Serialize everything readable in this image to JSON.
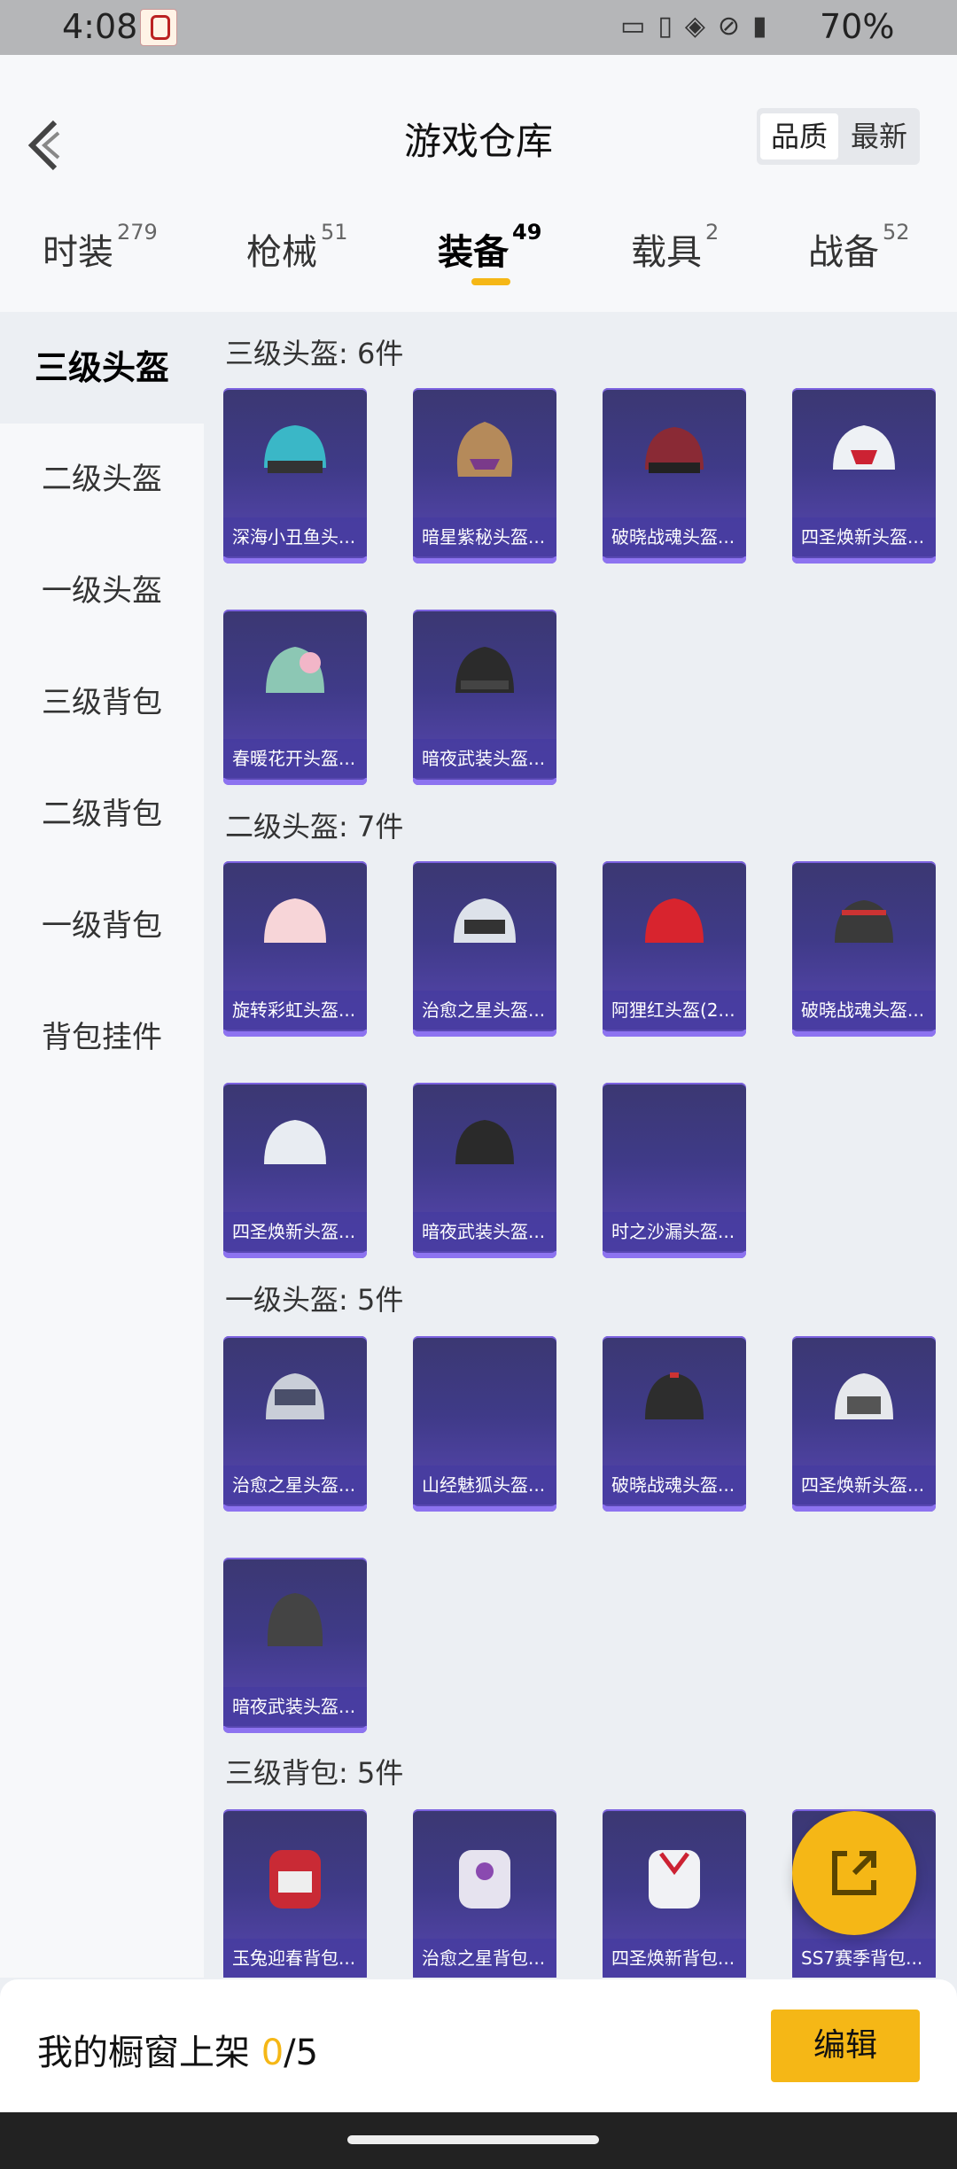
{
  "status_bar": {
    "time": "4:08",
    "battery": "70%"
  },
  "header": {
    "title": "游戏仓库",
    "sort_options": [
      "品质",
      "最新"
    ]
  },
  "tabs": [
    {
      "label": "时装",
      "count": "279"
    },
    {
      "label": "枪械",
      "count": "51"
    },
    {
      "label": "装备",
      "count": "49"
    },
    {
      "label": "载具",
      "count": "2"
    },
    {
      "label": "战备",
      "count": "52"
    }
  ],
  "sidebar": [
    "三级头盔",
    "二级头盔",
    "一级头盔",
    "三级背包",
    "二级背包",
    "一级背包",
    "背包挂件"
  ],
  "sections": [
    {
      "title": "三级头盔: 6件",
      "items": [
        "深海小丑鱼头...",
        "暗星紫秘头盔...",
        "破晓战魂头盔...",
        "四圣焕新头盔...",
        "春暖花开头盔...",
        "暗夜武装头盔..."
      ]
    },
    {
      "title": "二级头盔: 7件",
      "items": [
        "旋转彩虹头盔...",
        "治愈之星头盔...",
        "阿狸红头盔(2...",
        "破晓战魂头盔...",
        "四圣焕新头盔...",
        "暗夜武装头盔...",
        "时之沙漏头盔..."
      ]
    },
    {
      "title": "一级头盔: 5件",
      "items": [
        "治愈之星头盔...",
        "山经魅狐头盔...",
        "破晓战魂头盔...",
        "四圣焕新头盔...",
        "暗夜武装头盔..."
      ]
    },
    {
      "title": "三级背包: 5件",
      "items": [
        "玉兔迎春背包...",
        "治愈之星背包...",
        "四圣焕新背包...",
        "SS7赛季背包..."
      ]
    }
  ],
  "footer": {
    "label": "我的橱窗上架 ",
    "count": "0",
    "total": "/5",
    "edit": "编辑"
  },
  "colors": {
    "accent": "#f5b716",
    "card": "#3f3a88"
  }
}
